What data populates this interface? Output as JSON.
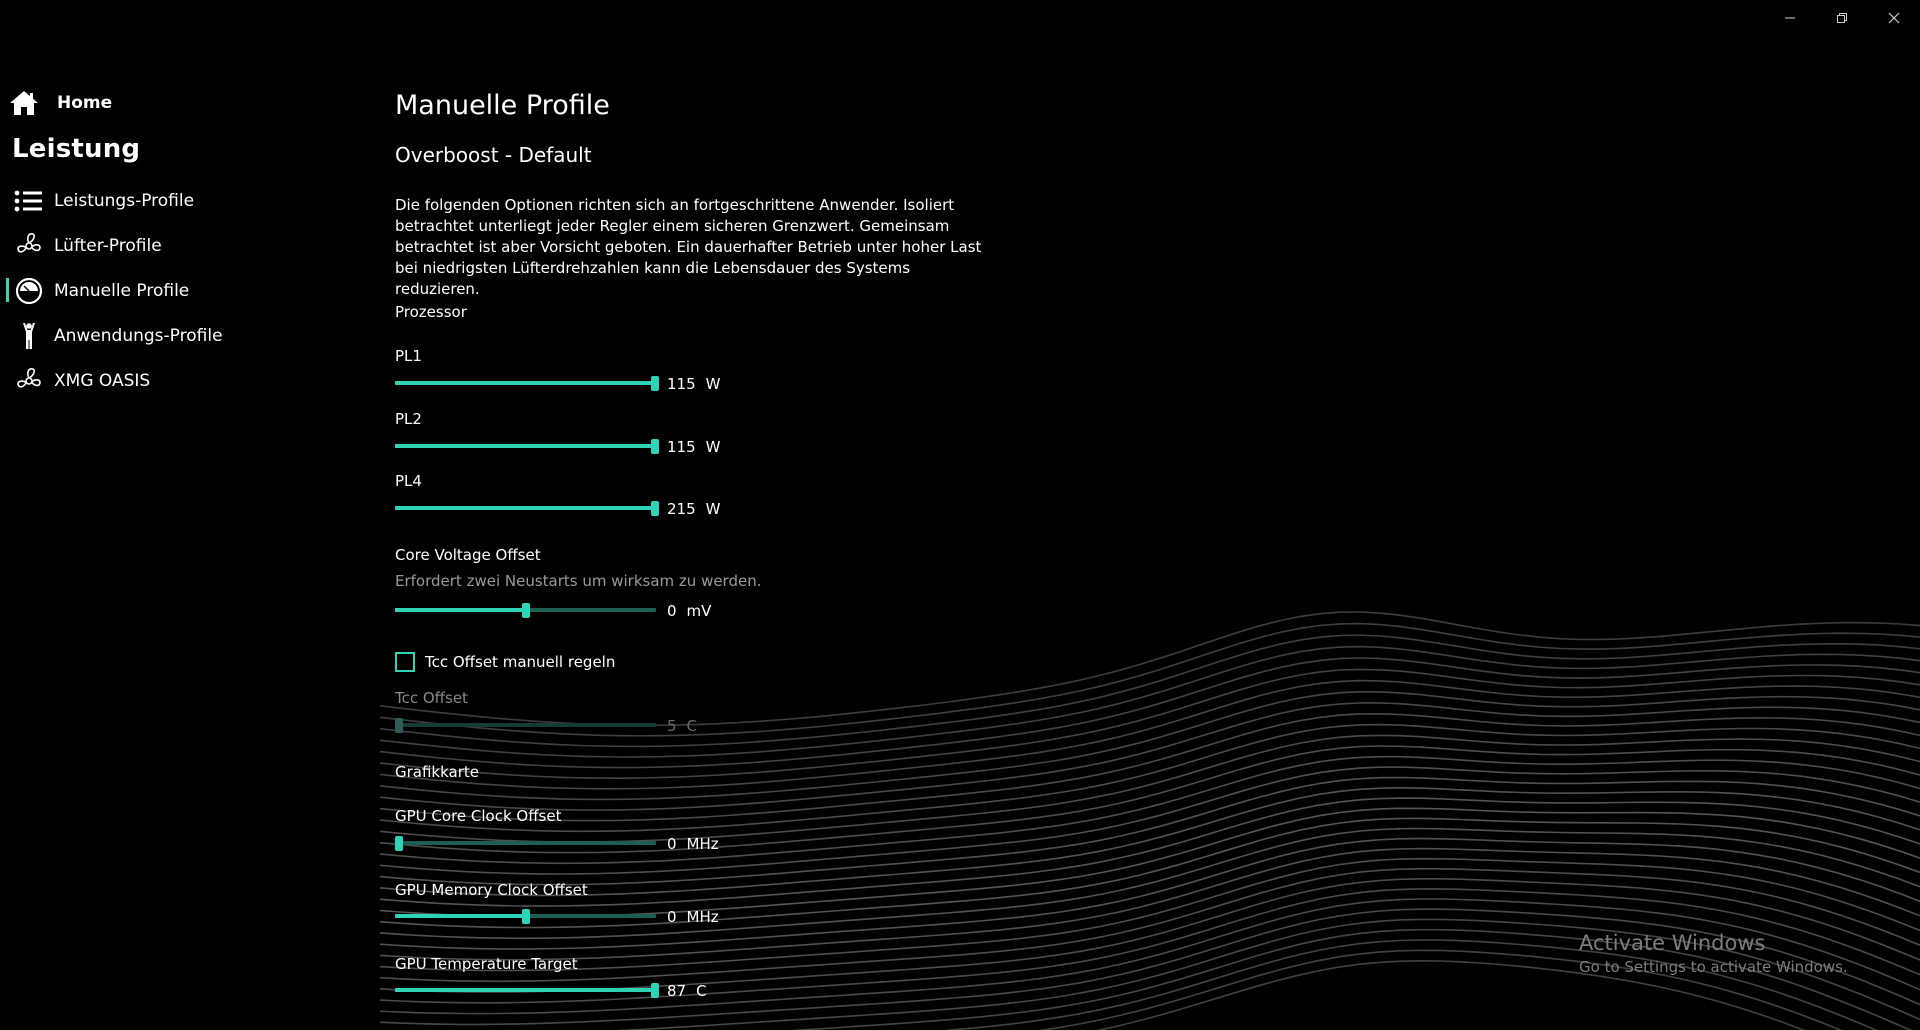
{
  "window": {
    "minimize_icon": "minimize-icon",
    "restore_icon": "restore-icon",
    "close_icon": "close-icon"
  },
  "sidebar": {
    "home_label": "Home",
    "section_title": "Leistung",
    "items": [
      {
        "label": "Leistungs-Profile",
        "icon": "list-icon",
        "active": false
      },
      {
        "label": "Lüfter-Profile",
        "icon": "fan-icon",
        "active": false
      },
      {
        "label": "Manuelle Profile",
        "icon": "gauge-icon",
        "active": true
      },
      {
        "label": "Anwendungs-Profile",
        "icon": "person-icon",
        "active": false
      },
      {
        "label": "XMG OASIS",
        "icon": "fan-icon",
        "active": false
      }
    ]
  },
  "main": {
    "title": "Manuelle Profile",
    "subtitle": "Overboost - Default",
    "description": "Die folgenden Optionen richten sich an fortgeschrittene Anwender. Isoliert betrachtet unterliegt jeder Regler einem sicheren Grenzwert. Gemeinsam betrachtet ist aber Vorsicht geboten. Ein dauerhafter Betrieb unter hoher Last bei niedrigsten Lüfterdrehzahlen kann die Lebensdauer des Systems reduzieren.",
    "processor": {
      "heading": "Prozessor",
      "pl1": {
        "label": "PL1",
        "value": "115",
        "unit": "W",
        "level": 1.0
      },
      "pl2": {
        "label": "PL2",
        "value": "115",
        "unit": "W",
        "level": 1.0
      },
      "pl4": {
        "label": "PL4",
        "value": "215",
        "unit": "W",
        "level": 1.0
      },
      "core_voltage": {
        "label": "Core Voltage Offset",
        "hint": "Erfordert zwei Neustarts um wirksam zu werden.",
        "value": "0",
        "unit": "mV",
        "level": 0.5
      },
      "tcc_checkbox": {
        "label": "Tcc Offset manuell regeln",
        "checked": false
      },
      "tcc_offset": {
        "label": "Tcc Offset",
        "value": "5",
        "unit": "C",
        "level": 0.0,
        "disabled": true
      }
    },
    "gpu": {
      "heading": "Grafikkarte",
      "core_clock": {
        "label": "GPU Core Clock Offset",
        "value": "0",
        "unit": "MHz",
        "level": 0.0
      },
      "memory_clock": {
        "label": "GPU Memory Clock Offset",
        "value": "0",
        "unit": "MHz",
        "level": 0.5
      },
      "temp_target": {
        "label": "GPU Temperature Target",
        "value": "87",
        "unit": "C",
        "level": 1.0
      }
    }
  },
  "watermark": {
    "line1": "Activate Windows",
    "line2": "Go to Settings to activate Windows."
  },
  "colors": {
    "accent": "#2fd3b5",
    "track": "#1e5e54",
    "background": "#000000"
  }
}
